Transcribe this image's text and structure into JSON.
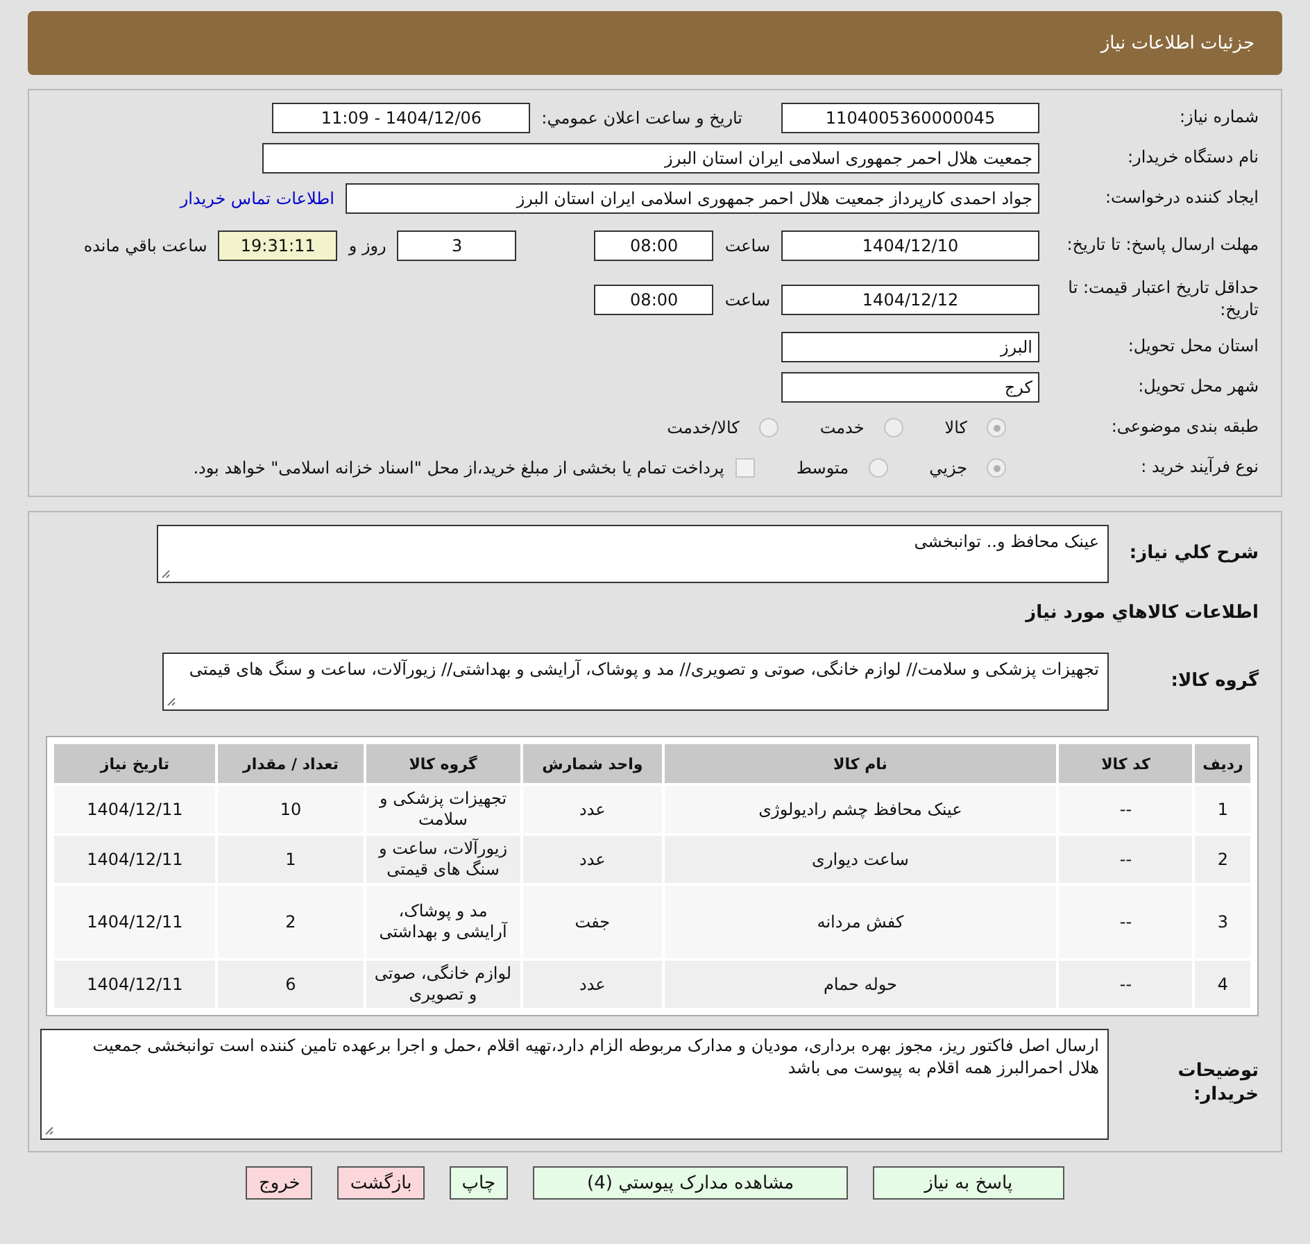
{
  "header": {
    "title": "جزئیات اطلاعات نیاز"
  },
  "need_number": {
    "label": "شماره نیاز:",
    "value": "1104005360000045"
  },
  "announce": {
    "label": "تاریخ و ساعت اعلان عمومي:",
    "value": "1404/12/06 - 11:09"
  },
  "buyer": {
    "label": "نام دستگاه خریدار:",
    "value": "جمعیت هلال احمر جمهوری اسلامی ایران استان البرز"
  },
  "requester": {
    "label": "ایجاد کننده درخواست:",
    "value": "جواد احمدی کارپرداز جمعیت هلال احمر جمهوری اسلامی ایران استان البرز",
    "link": "اطلاعات تماس خریدار"
  },
  "reply_deadline": {
    "label": "مهلت ارسال پاسخ: تا تاریخ:",
    "date": "1404/12/10",
    "time_label": "ساعت",
    "time": "08:00",
    "days": "3",
    "days_label": "روز و",
    "remaining": "19:31:11",
    "remaining_label": "ساعت باقي مانده"
  },
  "price_validity": {
    "label": "حداقل تاریخ اعتبار قیمت: تا تاریخ:",
    "date": "1404/12/12",
    "time_label": "ساعت",
    "time": "08:00"
  },
  "province": {
    "label": "استان محل تحویل:",
    "value": "البرز"
  },
  "city": {
    "label": "شهر محل تحویل:",
    "value": "کرج"
  },
  "category": {
    "label": "طبقه بندی موضوعی:",
    "options": [
      {
        "label": "کالا",
        "selected": true
      },
      {
        "label": "خدمت",
        "selected": false
      },
      {
        "label": "کالا/خدمت",
        "selected": false
      }
    ]
  },
  "purchase_type": {
    "label": "نوع فرآیند خرید :",
    "options": [
      {
        "label": "جزيي",
        "selected": true
      },
      {
        "label": "متوسط",
        "selected": false
      }
    ],
    "treasury": {
      "checked": false,
      "label": "پرداخت تمام یا بخشی از مبلغ خرید،از محل \"اسناد خزانه اسلامی\" خواهد بود."
    }
  },
  "description": {
    "label": "شرح کلي نیاز:",
    "value": "عینک محافظ و.. توانبخشی"
  },
  "items_title": "اطلاعات کالاهاي مورد نیاز",
  "goods_group": {
    "label": "گروه کالا:",
    "value": "تجهیزات پزشکی و سلامت// لوازم خانگی، صوتی و تصویری// مد و پوشاک، آرایشی و بهداشتی// زیورآلات، ساعت و سنگ های قیمتی"
  },
  "table": {
    "columns": [
      "ردیف",
      "کد کالا",
      "نام کالا",
      "واحد شمارش",
      "گروه کالا",
      "تعداد / مقدار",
      "تاریخ نیاز"
    ],
    "rows": [
      [
        "1",
        "--",
        "عینک محافظ چشم رادیولوژی",
        "عدد",
        "تجهیزات پزشکی و سلامت",
        "10",
        "1404/12/11"
      ],
      [
        "2",
        "--",
        "ساعت دیواری",
        "عدد",
        "زیورآلات، ساعت و سنگ های قیمتی",
        "1",
        "1404/12/11"
      ],
      [
        "3",
        "--",
        "کفش مردانه",
        "جفت",
        "مد و پوشاک، آرایشی و بهداشتی",
        "2",
        "1404/12/11"
      ],
      [
        "4",
        "--",
        "حوله حمام",
        "عدد",
        "لوازم خانگی، صوتی و تصویری",
        "6",
        "1404/12/11"
      ]
    ]
  },
  "buyer_notes": {
    "label": "توضیحات خریدار:",
    "value": "ارسال اصل فاکتور ریز، مجوز بهره برداری، مودیان و مدارک مربوطه الزام دارد،تهیه اقلام ،حمل و اجرا  برعهده تامین کننده است  توانبخشی جمعیت هلال احمرالبرز همه اقلام به پیوست می باشد"
  },
  "buttons": [
    {
      "label": "پاسخ به نیاز",
      "kind": "action"
    },
    {
      "label": "مشاهده مدارک پیوستي (4)",
      "kind": "action"
    },
    {
      "label": "چاپ",
      "kind": "action"
    },
    {
      "label": "بازگشت",
      "kind": "exit"
    },
    {
      "label": "خروج",
      "kind": "exit"
    }
  ]
}
